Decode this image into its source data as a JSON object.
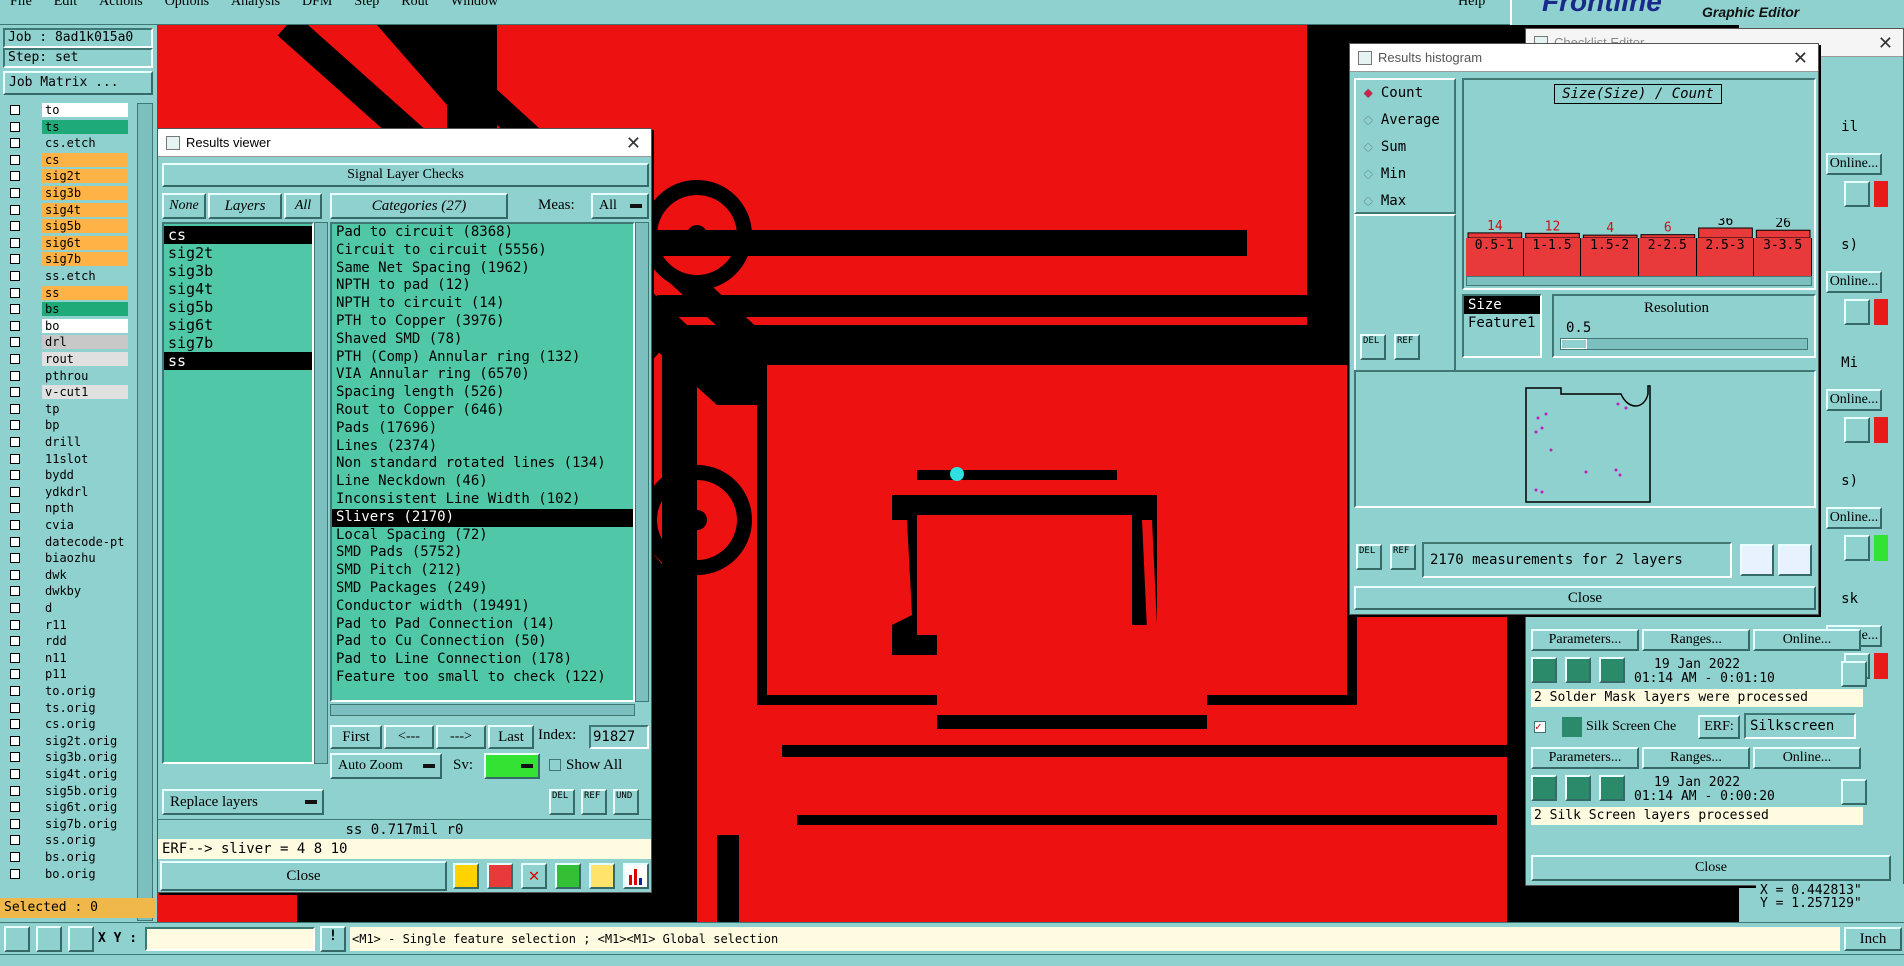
{
  "menubar": {
    "items": [
      "File",
      "Edit",
      "Actions",
      "Options",
      "Analysis",
      "DFM",
      "Step",
      "Rout",
      "Window"
    ],
    "help": "Help"
  },
  "job": {
    "name": "Job : 8ad1k015a0",
    "step": "Step: set",
    "matrix_button": "Job Matrix ..."
  },
  "layers": [
    {
      "name": "to",
      "color": "#ffffff"
    },
    {
      "name": "ts",
      "color": "#1faa7a"
    },
    {
      "name": "cs.etch",
      "color": "#8fd1cf"
    },
    {
      "name": "cs",
      "color": "#ffb347"
    },
    {
      "name": "sig2t",
      "color": "#ffb347"
    },
    {
      "name": "sig3b",
      "color": "#ffb347"
    },
    {
      "name": "sig4t",
      "color": "#ffb347"
    },
    {
      "name": "sig5b",
      "color": "#ffb347"
    },
    {
      "name": "sig6t",
      "color": "#ffb347"
    },
    {
      "name": "sig7b",
      "color": "#ffb347"
    },
    {
      "name": "ss.etch",
      "color": "#8fd1cf"
    },
    {
      "name": "ss",
      "color": "#ffb347"
    },
    {
      "name": "bs",
      "color": "#1faa7a"
    },
    {
      "name": "bo",
      "color": "#ffffff"
    },
    {
      "name": "drl",
      "color": "#c8c8c8"
    },
    {
      "name": "rout",
      "color": "#e0e0e0"
    },
    {
      "name": "pthrou",
      "color": "#8fd1cf"
    },
    {
      "name": "v-cut1",
      "color": "#e0e0e0"
    },
    {
      "name": "tp",
      "color": "#8fd1cf"
    },
    {
      "name": "bp",
      "color": "#8fd1cf"
    },
    {
      "name": "drill",
      "color": "#8fd1cf"
    },
    {
      "name": "11slot",
      "color": "#8fd1cf"
    },
    {
      "name": "bydd",
      "color": "#8fd1cf"
    },
    {
      "name": "ydkdrl",
      "color": "#8fd1cf"
    },
    {
      "name": "npth",
      "color": "#8fd1cf"
    },
    {
      "name": "cvia",
      "color": "#8fd1cf"
    },
    {
      "name": "datecode-pt",
      "color": "#8fd1cf"
    },
    {
      "name": "biaozhu",
      "color": "#8fd1cf"
    },
    {
      "name": "dwk",
      "color": "#8fd1cf"
    },
    {
      "name": "dwkby",
      "color": "#8fd1cf"
    },
    {
      "name": "d",
      "color": "#8fd1cf"
    },
    {
      "name": "r11",
      "color": "#8fd1cf"
    },
    {
      "name": "rdd",
      "color": "#8fd1cf"
    },
    {
      "name": "n11",
      "color": "#8fd1cf"
    },
    {
      "name": "p11",
      "color": "#8fd1cf"
    },
    {
      "name": "to.orig",
      "color": "#8fd1cf"
    },
    {
      "name": "ts.orig",
      "color": "#8fd1cf"
    },
    {
      "name": "cs.orig",
      "color": "#8fd1cf"
    },
    {
      "name": "sig2t.orig",
      "color": "#8fd1cf"
    },
    {
      "name": "sig3b.orig",
      "color": "#8fd1cf"
    },
    {
      "name": "sig4t.orig",
      "color": "#8fd1cf"
    },
    {
      "name": "sig5b.orig",
      "color": "#8fd1cf"
    },
    {
      "name": "sig6t.orig",
      "color": "#8fd1cf"
    },
    {
      "name": "sig7b.orig",
      "color": "#8fd1cf"
    },
    {
      "name": "ss.orig",
      "color": "#8fd1cf"
    },
    {
      "name": "bs.orig",
      "color": "#8fd1cf"
    },
    {
      "name": "bo.orig",
      "color": "#8fd1cf"
    }
  ],
  "selected_count": "Selected : 0",
  "results_viewer": {
    "title": "Results viewer",
    "header": "Signal Layer Checks",
    "none_btn": "None",
    "layers_btn": "Layers",
    "all_btn": "All",
    "categories_btn": "Categories (27)",
    "meas_label": "Meas:",
    "meas_value": "All",
    "layer_list": [
      "cs",
      "sig2t",
      "sig3b",
      "sig4t",
      "sig5b",
      "sig6t",
      "sig7b",
      "ss"
    ],
    "categories": [
      "Pad to circuit (8368)",
      "Circuit to circuit (5556)",
      "Same Net Spacing (1962)",
      "NPTH to pad (12)",
      "NPTH to circuit (14)",
      "PTH to Copper (3976)",
      "Shaved SMD (78)",
      "PTH (Comp) Annular ring (132)",
      "VIA Annular ring (6570)",
      "Spacing length (526)",
      "Rout to Copper (646)",
      "Pads (17696)",
      "Lines (2374)",
      "Non standard rotated lines (134)",
      "Line Neckdown (46)",
      "Inconsistent Line Width (102)",
      "Slivers (2170)",
      "Local Spacing (72)",
      "SMD Pads (5752)",
      "SMD Pitch (212)",
      "SMD Packages (249)",
      "Conductor width (19491)",
      "Pad to Pad Connection (14)",
      "Pad to Cu Connection (50)",
      "Pad to Line Connection (178)",
      "Feature too small to check (122)"
    ],
    "selected_category": "Slivers (2170)",
    "first_btn": "First",
    "prev_btn": "<---",
    "next_btn": "--->",
    "last_btn": "Last",
    "index_label": "Index:",
    "index_value": "91827",
    "auto_zoom": "Auto Zoom",
    "sv_label": "Sv:",
    "show_all": "Show All",
    "replace_layers": "Replace layers",
    "status": "ss 0.717mil  r0",
    "erf_line": "ERF--> sliver = 4 8 10",
    "close": "Close"
  },
  "histogram": {
    "title": "Results histogram",
    "modes": [
      "Count",
      "Average",
      "Sum",
      "Min",
      "Max"
    ],
    "active_mode": "Count",
    "chart_title": "Size(Size) / Count",
    "bars": [
      {
        "range": "0.5-1",
        "count": 14
      },
      {
        "range": "1-1.5",
        "count": 12
      },
      {
        "range": "1.5-2",
        "count": 4
      },
      {
        "range": "2-2.5",
        "count": 6
      },
      {
        "range": "2.5-3",
        "count": 36
      },
      {
        "range": "3-3.5",
        "count": 26
      }
    ],
    "attr_list": [
      "Size",
      "Feature1"
    ],
    "resolution_label": "Resolution",
    "resolution_value": "0.5",
    "measurement_text": "2170 measurements for 2 layers",
    "close": "Close",
    "del": "DEL",
    "ref": "REF"
  },
  "checklist": {
    "title": "Checklist Editor",
    "brand": "Frontline",
    "subtitle": "Graphic Editor",
    "params": "Parameters...",
    "ranges": "Ranges...",
    "online": "Online...",
    "date1": "19 Jan 2022",
    "time1": "01:14 AM - 0:01:10",
    "msg1": "2 Solder Mask layers were processed",
    "silk_label": "Silk Screen Che",
    "erf": "ERF:",
    "silk_value": "Silkscreen",
    "date2": "19 Jan 2022",
    "time2": "01:14 AM - 0:00:20",
    "msg2": "2 Silk Screen layers processed",
    "close": "Close",
    "partial1": "il",
    "partial2": "s)",
    "partial3": "Mi",
    "partial4": "s)",
    "partial5": "sk",
    "online_short": "Online..."
  },
  "coords": {
    "x": "X = 0.442813\"",
    "y": "Y = 1.257129\""
  },
  "statusbar": {
    "xy_label": "X Y :",
    "message": "<M1> - Single feature selection ; <M1><M1> Global selection",
    "units": "Inch"
  }
}
